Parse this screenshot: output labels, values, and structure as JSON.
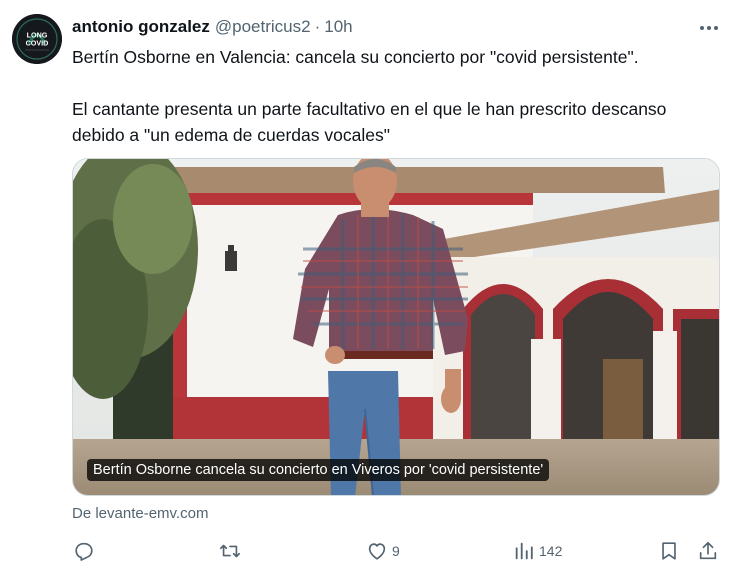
{
  "author": {
    "name": "antonio gonzalez",
    "handle": "@poetricus2",
    "separator": "·",
    "time": "10h",
    "avatar_text": {
      "line1": "LONG",
      "line2": "COVID",
      "ring_text": "LONG COVID"
    }
  },
  "tweet": {
    "paragraphs": [
      "Bertín Osborne en Valencia: cancela su concierto por \"covid persistente\".",
      "El cantante presenta un parte facultativo en el que le han prescrito descanso debido a \"un edema de cuerdas vocales\""
    ]
  },
  "card": {
    "caption": "Bertín Osborne cancela su concierto en Viveros por 'covid persistente'",
    "source": "De levante-emv.com"
  },
  "actions": {
    "reply_count": "",
    "retweet_count": "",
    "like_count": "9",
    "views_count": "142"
  },
  "colors": {
    "text_primary": "#0f1419",
    "text_secondary": "#536471",
    "border": "#cfd9de"
  },
  "icons": [
    "avatar",
    "more-icon",
    "reply-icon",
    "retweet-icon",
    "like-icon",
    "views-icon",
    "bookmark-icon",
    "share-icon"
  ]
}
